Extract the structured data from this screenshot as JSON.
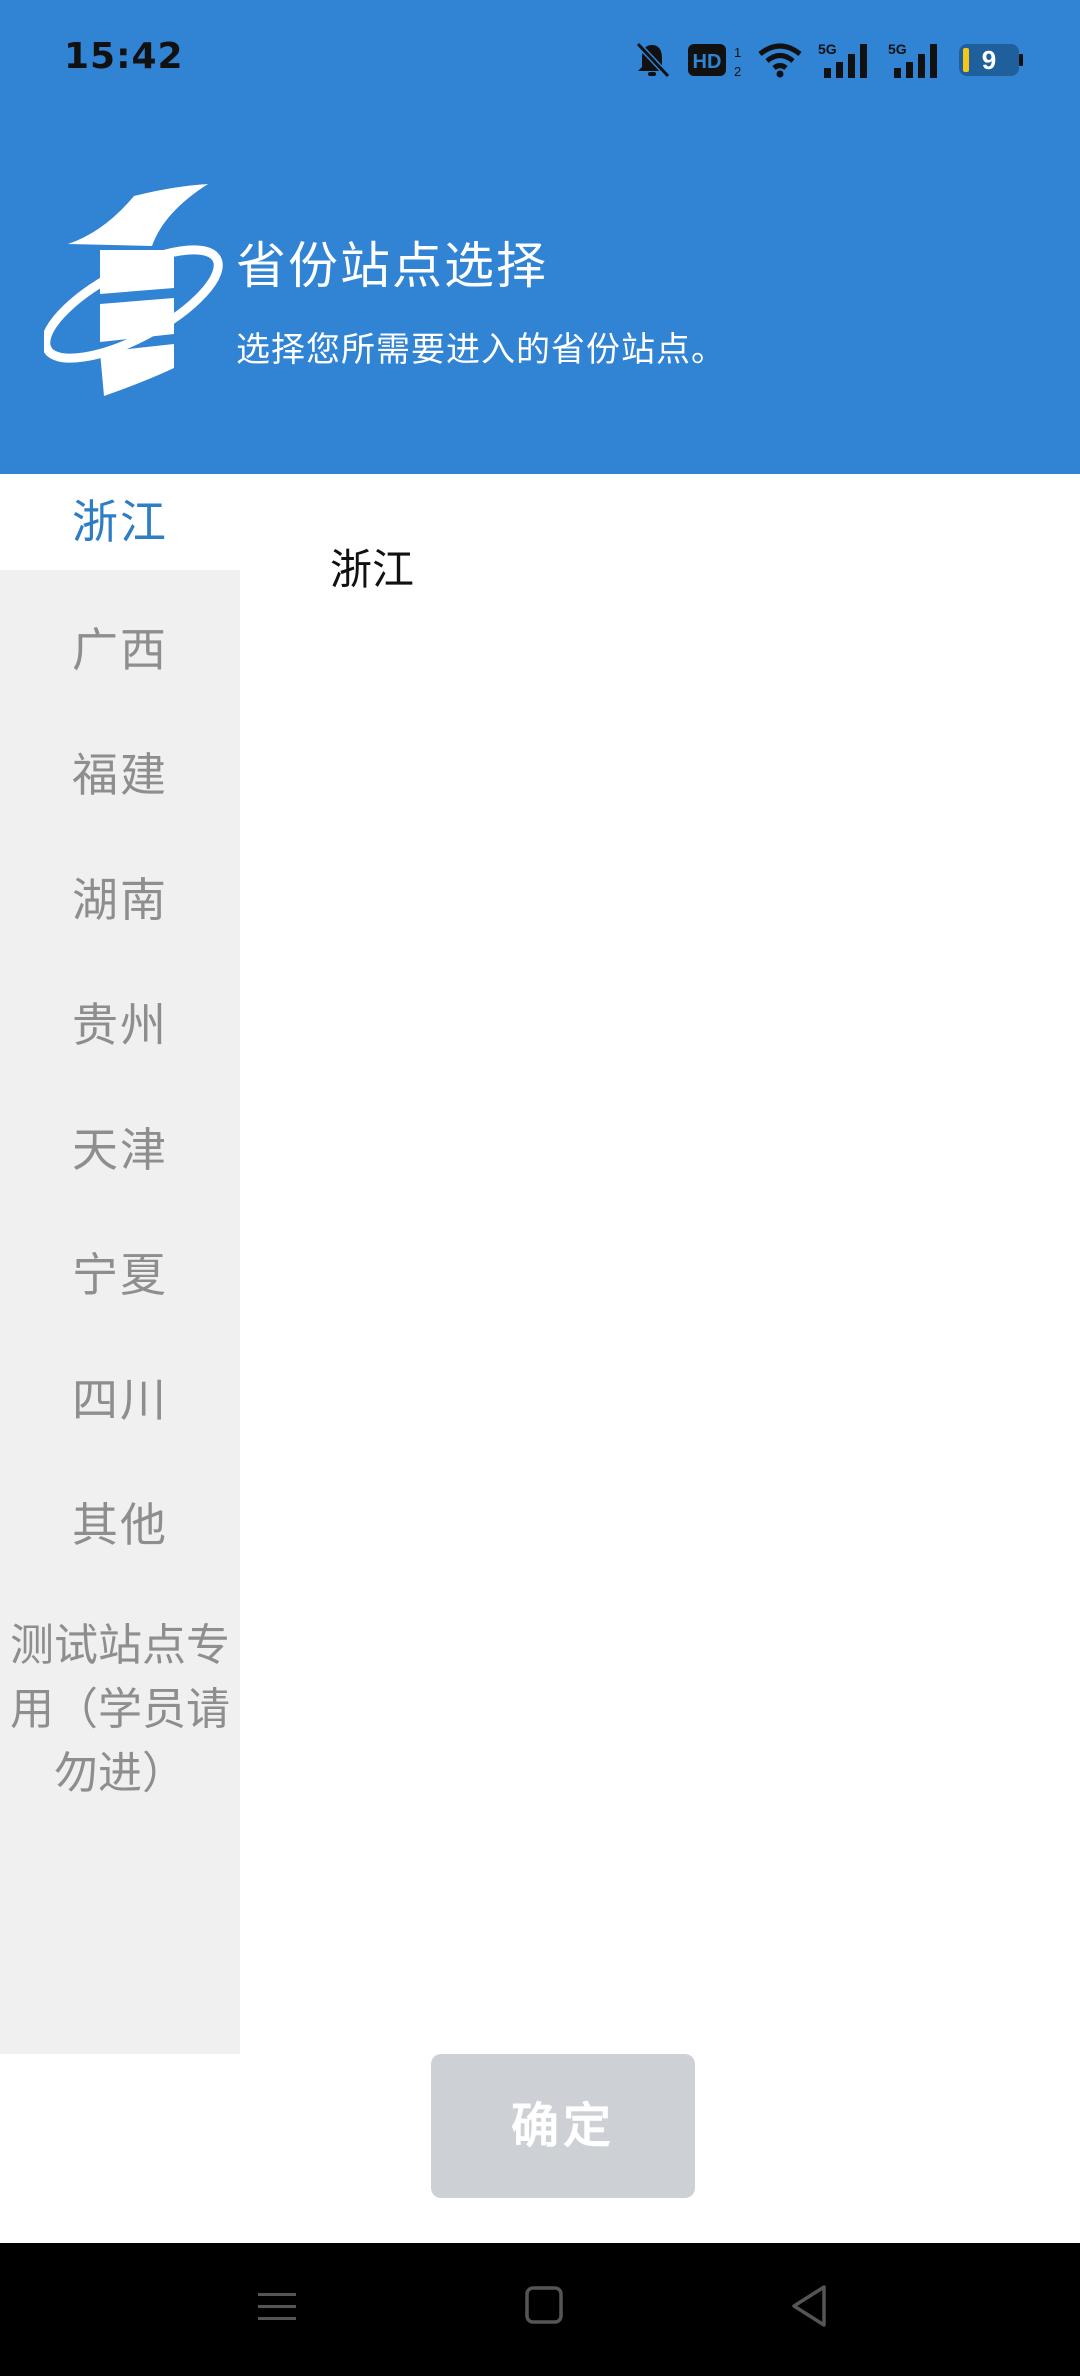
{
  "status_bar": {
    "time": "15:42",
    "icons": [
      "mute-bell-icon",
      "hd-icon",
      "wifi-icon",
      "5g-signal-icon",
      "5g-signal-icon",
      "battery-icon"
    ],
    "battery_level": "9",
    "colors": {
      "battery_fill": "#f5c518"
    }
  },
  "header": {
    "title": "省份站点选择",
    "subtitle": "选择您所需要进入的省份站点。",
    "background": "#3183d4"
  },
  "sidebar": {
    "items": [
      {
        "label": "浙江",
        "selected": true
      },
      {
        "label": "广西",
        "selected": false
      },
      {
        "label": "福建",
        "selected": false
      },
      {
        "label": "湖南",
        "selected": false
      },
      {
        "label": "贵州",
        "selected": false
      },
      {
        "label": "天津",
        "selected": false
      },
      {
        "label": "宁夏",
        "selected": false
      },
      {
        "label": "四川",
        "selected": false
      },
      {
        "label": "其他",
        "selected": false
      },
      {
        "label": "测试站点专用（学员请勿进）",
        "selected": false
      }
    ],
    "multiline_label_lines": [
      "测试站点专",
      "用（学员请",
      "勿进）"
    ]
  },
  "content": {
    "items": [
      {
        "label": "浙江"
      }
    ]
  },
  "confirm_button": {
    "label": "确定"
  },
  "nav_bar": {
    "buttons": [
      "menu-icon",
      "home-icon",
      "back-icon"
    ]
  }
}
